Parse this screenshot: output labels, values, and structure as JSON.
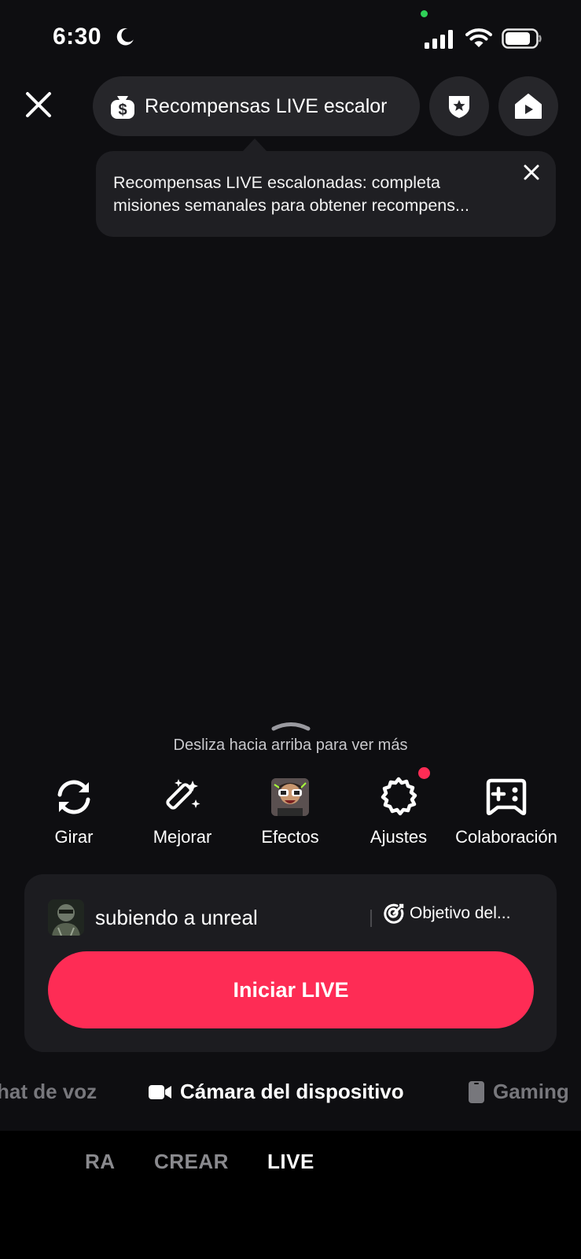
{
  "status_bar": {
    "time": "6:30"
  },
  "top": {
    "rewards_label": "Recompensas LIVE escalor",
    "tooltip_text": "Recompensas LIVE escalonadas: completa misiones semanales para obtener recompens..."
  },
  "swipe_hint": "Desliza hacia arriba para ver más",
  "tools": {
    "rotate": "Girar",
    "enhance": "Mejorar",
    "effects": "Efectos",
    "settings": "Ajustes",
    "collab": "Colaboración"
  },
  "card": {
    "title": "subiendo a unreal",
    "objective": "Objetivo del...",
    "start_button": "Iniciar LIVE"
  },
  "modes": {
    "voice_chat": "hat de voz",
    "device_camera": "Cámara del dispositivo",
    "gaming": "Gaming"
  },
  "bottom_nav": {
    "prev": "RA",
    "create": "CREAR",
    "live": "LIVE"
  },
  "colors": {
    "accent": "#fe2c55",
    "background": "#0e0e11",
    "pill": "#26262a"
  }
}
